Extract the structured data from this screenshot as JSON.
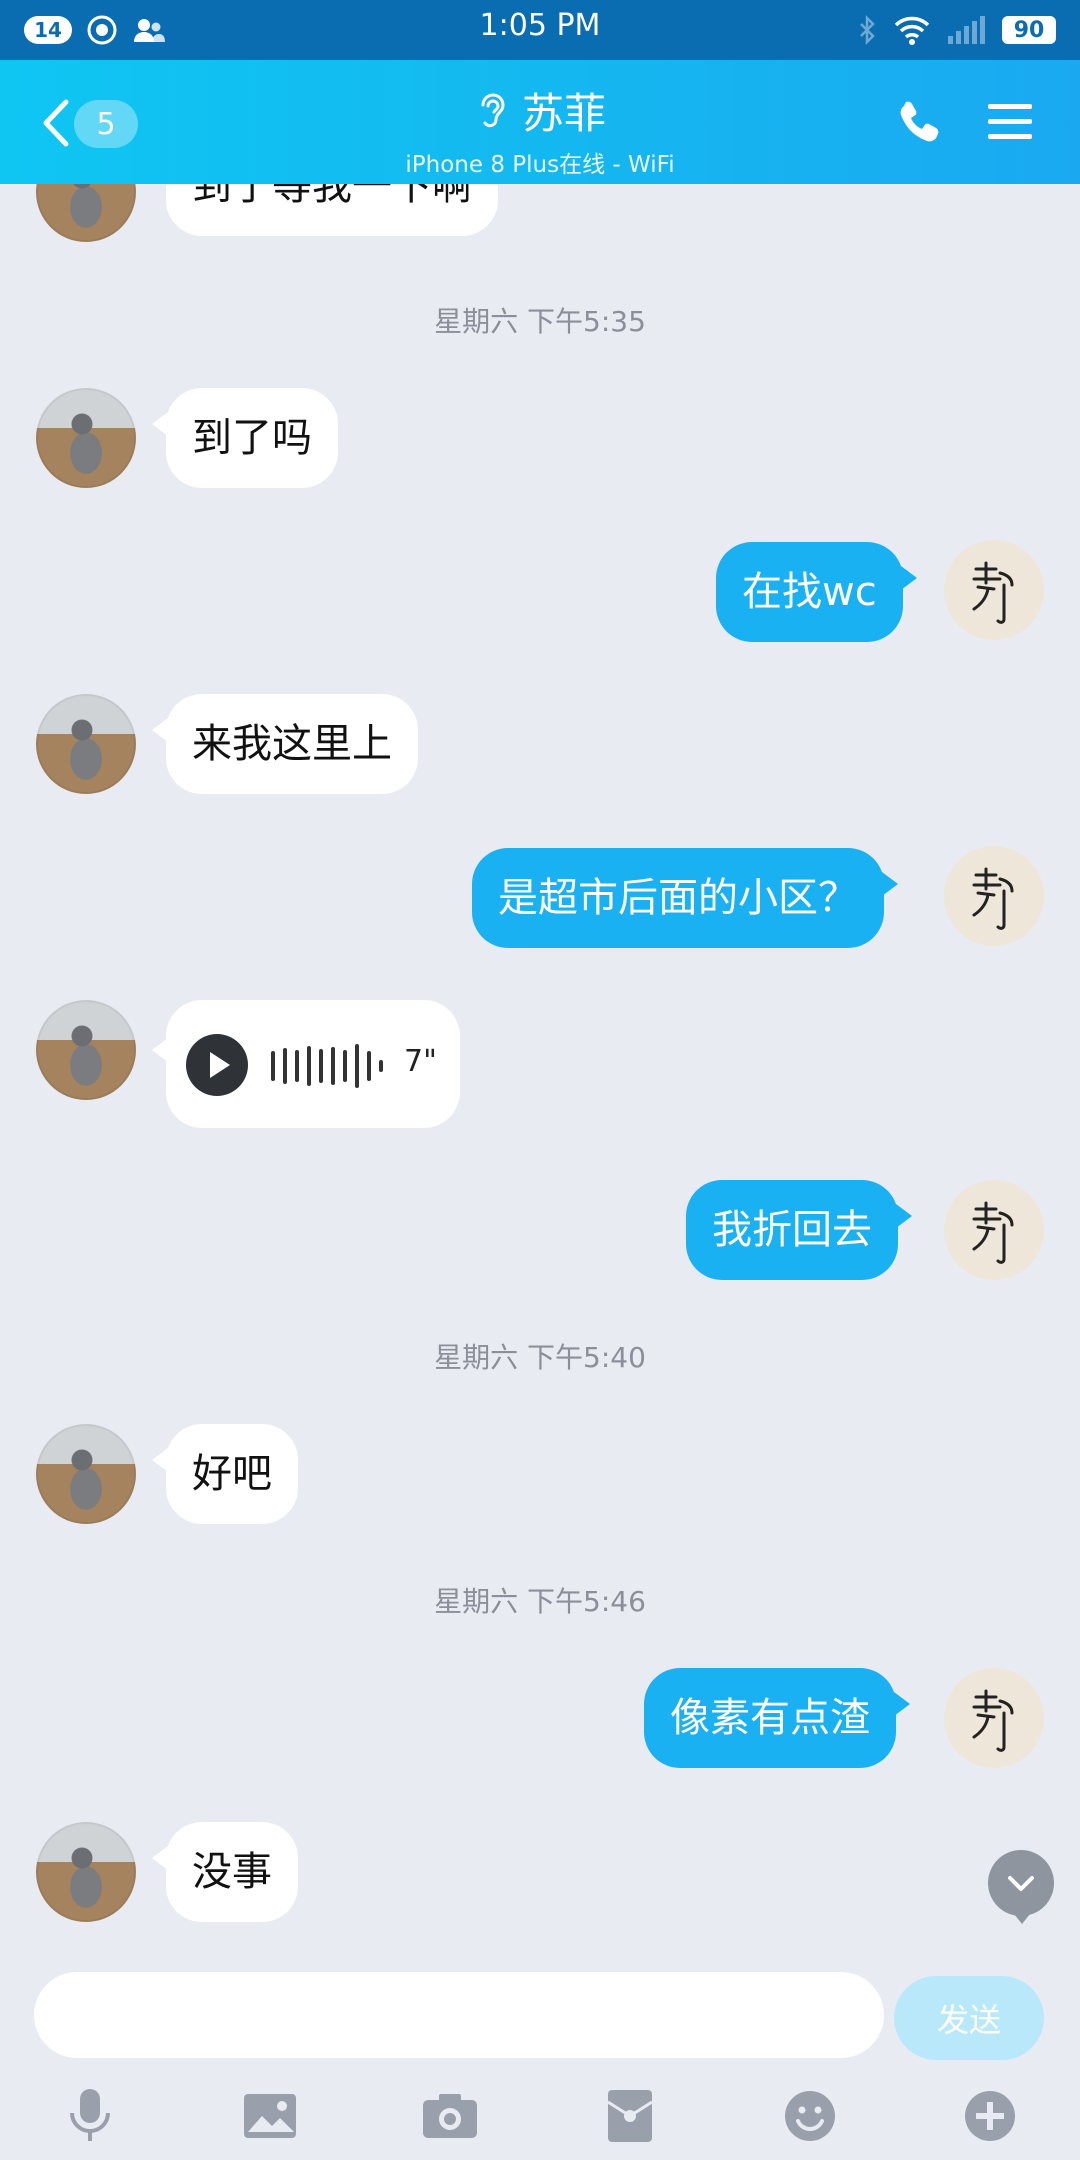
{
  "status_bar": {
    "time": "1:05 PM",
    "notification_count": "14",
    "battery": "90"
  },
  "header": {
    "back_count": "5",
    "contact_name": "苏菲",
    "status": "iPhone 8 Plus在线 - WiFi"
  },
  "messages": {
    "m0": "到了等我一下啊",
    "t1": "星期六 下午5:35",
    "m1": "到了吗",
    "m2": "在找wc",
    "m3": "来我这里上",
    "m4": "是超市后面的小区？",
    "voice_duration": "7\"",
    "m6": "我折回去",
    "t2": "星期六 下午5:40",
    "m7": "好吧",
    "t3": "星期六 下午5:46",
    "m8": "像素有点渣",
    "m9": "没事"
  },
  "composer": {
    "input_value": "",
    "send_label": "发送"
  },
  "colors": {
    "header_gradient_start": "#0fc6f3",
    "header_gradient_end": "#1aa9f1",
    "outgoing_bubble": "#1ab1f2",
    "chat_background": "#e9ebf3"
  },
  "icons": [
    "back-chevron-icon",
    "ear-icon",
    "phone-icon",
    "menu-icon",
    "microphone-icon",
    "image-icon",
    "camera-icon",
    "red-packet-icon",
    "emoji-icon",
    "plus-icon",
    "play-icon",
    "scroll-down-icon"
  ]
}
